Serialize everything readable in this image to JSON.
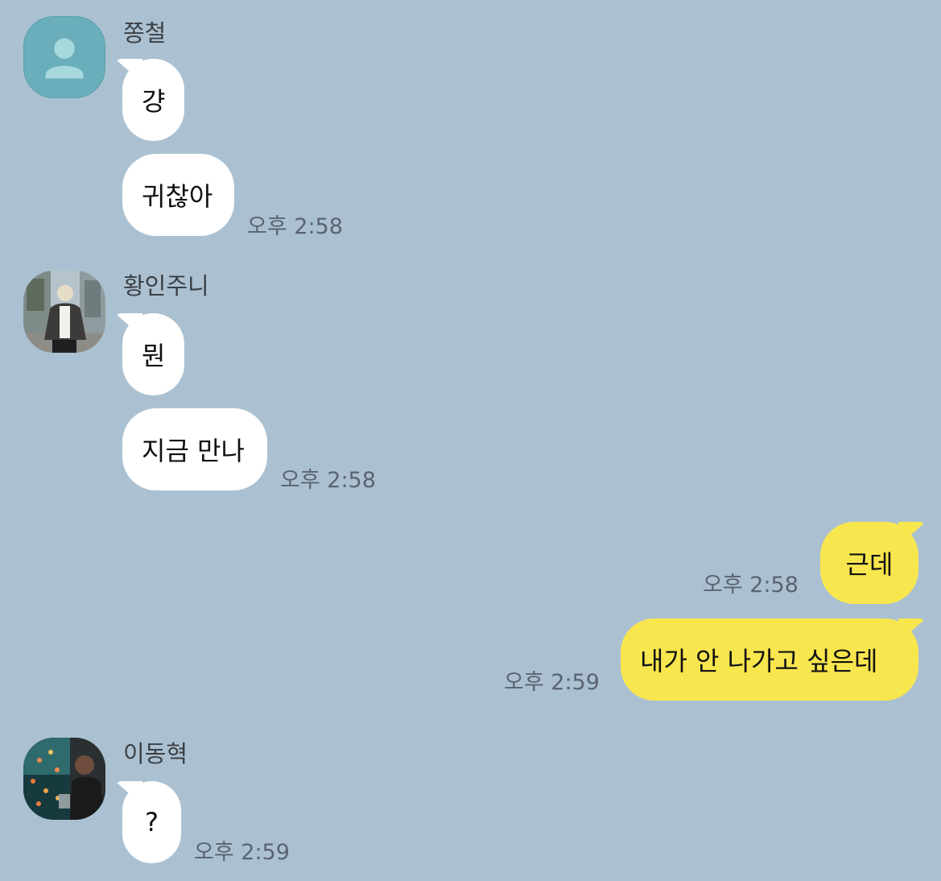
{
  "messages": [
    {
      "sender": "쫑철",
      "texts": [
        "걍",
        "귀찮아"
      ],
      "time": "오후 2:58"
    },
    {
      "sender": "황인주니",
      "texts": [
        "뭔",
        "지금 만나"
      ],
      "time": "오후 2:58"
    },
    {
      "mine": true,
      "texts": [
        "근데"
      ],
      "time": "오후 2:58"
    },
    {
      "mine": true,
      "texts": [
        "내가 안 나가고 싶은데"
      ],
      "time": "오후 2:59"
    },
    {
      "sender": "이동혁",
      "texts": [
        "?"
      ],
      "time": "오후 2:59"
    }
  ],
  "colors": {
    "background": "#abc1d1",
    "incoming_bubble": "#ffffff",
    "outgoing_bubble": "#f8e64e",
    "default_avatar": "#69aeba"
  },
  "icons": [
    "default-person-icon"
  ]
}
